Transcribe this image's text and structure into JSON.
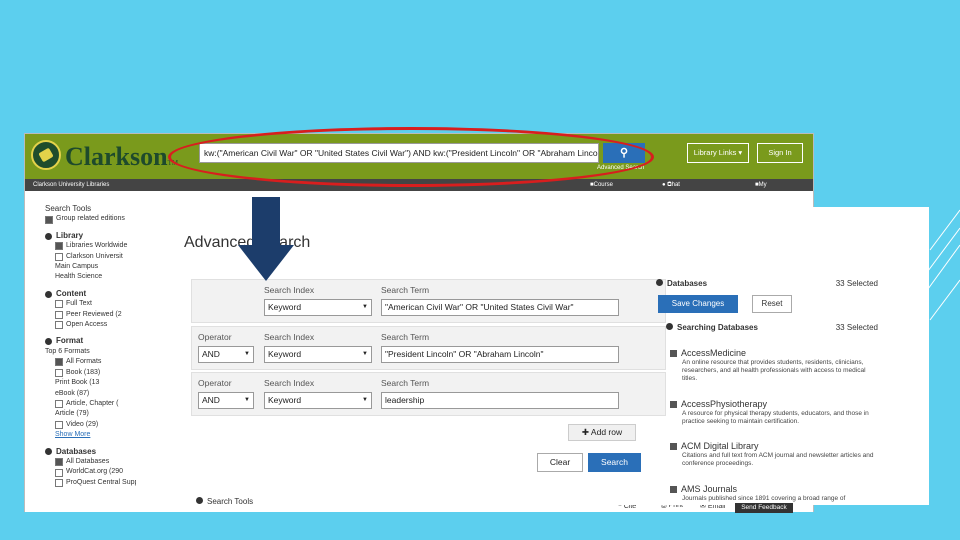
{
  "back": {
    "logo": "Clarkson",
    "logo_tm": "TM",
    "search_query": "kw:(\"American Civil War\" OR \"United States Civil War\") AND kw:(\"President Lincoln\" OR \"Abraham Linco",
    "advanced_link": "Advanced Search",
    "library_links": "Library Links",
    "sign_in": "Sign In",
    "sub_title": "Clarkson University Libraries",
    "course_reserves": "Course Reserves",
    "chat": "Chat with a librarian",
    "my_items": "My Items (0)",
    "sidebar": {
      "search_tools": "Search Tools",
      "group_related": "Group related editions",
      "library": "Library",
      "libraries_worldwide": "Libraries Worldwide",
      "clarkson_univ": "Clarkson Universit",
      "main_campus": "Main Campus",
      "health_science": "Health Science",
      "content": "Content",
      "full_text": "Full Text",
      "peer_reviewed": "Peer Reviewed (2",
      "open_access": "Open Access",
      "format": "Format",
      "top6": "Top 6 Formats",
      "all_formats": "All Formats",
      "book": "Book (183)",
      "print_book": "Print Book (13",
      "ebook": "eBook (87)",
      "article_chapter": "Article, Chapter (",
      "article": "Article (79)",
      "video": "Video (29)",
      "show_more": "Show More",
      "databases": "Databases",
      "all_databases": "All Databases",
      "worldcat": "WorldCat.org (290",
      "proquest": "ProQuest Central Suppl. (21"
    },
    "footer": {
      "cite": "Cite",
      "print": "Print",
      "email": "Email"
    }
  },
  "front": {
    "title": "Advanced Search",
    "rows": [
      {
        "search_index_label": "Search Index",
        "search_term_label": "Search Term",
        "index": "Keyword",
        "term": "\"American Civil War\" OR \"United States Civil War\""
      },
      {
        "operator_label": "Operator",
        "operator": "AND",
        "search_index_label": "Search Index",
        "search_term_label": "Search Term",
        "index": "Keyword",
        "term": "\"President Lincoln\" OR \"Abraham Lincoln\""
      },
      {
        "operator_label": "Operator",
        "operator": "AND",
        "search_index_label": "Search Index",
        "search_term_label": "Search Term",
        "index": "Keyword",
        "term": "leadership"
      }
    ],
    "add_row": "Add row",
    "clear": "Clear",
    "search": "Search",
    "search_tools": "Search Tools",
    "databases": {
      "heading": "Databases",
      "count": "33 Selected",
      "save_changes": "Save Changes",
      "reset": "Reset",
      "searching_heading": "Searching Databases",
      "searching_count": "33 Selected",
      "items": [
        {
          "name": "AccessMedicine",
          "desc": "An online resource that provides students, residents, clinicians, researchers, and all health professionals with access to medical titles."
        },
        {
          "name": "AccessPhysiotherapy",
          "desc": "A resource for physical therapy students, educators, and those in practice seeking to maintain certification."
        },
        {
          "name": "ACM Digital Library",
          "desc": "Citations and full text from ACM journal and newsletter articles and conference proceedings."
        },
        {
          "name": "AMS Journals",
          "desc": "Journals published since 1891 covering a broad range of"
        }
      ]
    },
    "feedback": "Send Feedback"
  },
  "colors": {
    "background": "#5ccfee",
    "header_green": "#7a9a1c",
    "accent_blue": "#2a6fb8",
    "oval_red": "#d81e1e",
    "arrow_navy": "#1c3d6b"
  }
}
